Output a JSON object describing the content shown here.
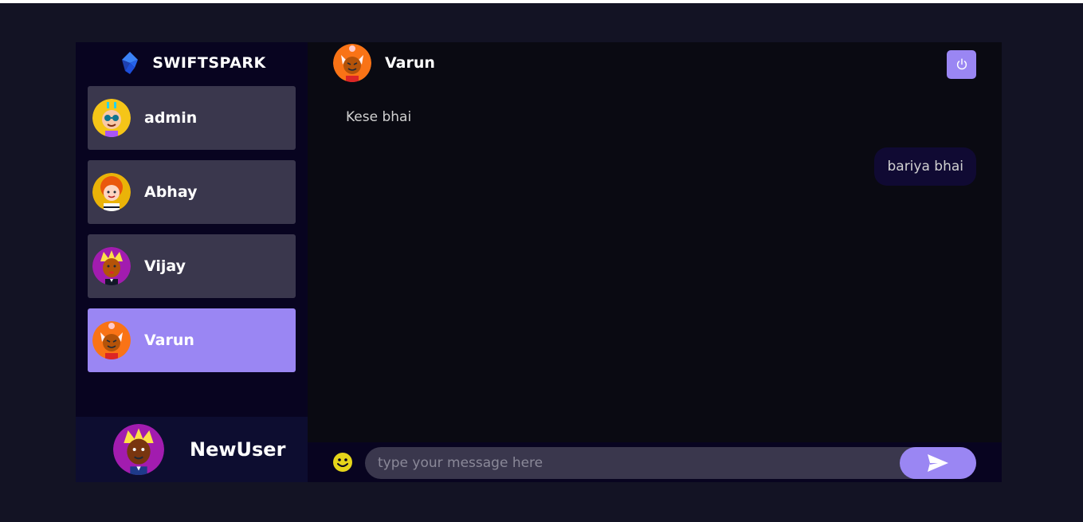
{
  "brand": {
    "name": "SWIFTSPARK",
    "logo_icon": "swiftspark-logo-icon"
  },
  "contacts": [
    {
      "name": "admin",
      "avatar": "avatar-glasses-icon",
      "selected": false
    },
    {
      "name": "Abhay",
      "avatar": "avatar-redhair-icon",
      "selected": false
    },
    {
      "name": "Vijay",
      "avatar": "avatar-blonde-icon",
      "selected": false
    },
    {
      "name": "Varun",
      "avatar": "avatar-orange-icon",
      "selected": true
    }
  ],
  "current_user": {
    "name": "NewUser",
    "avatar": "avatar-blonde-icon"
  },
  "chat": {
    "contact_name": "Varun",
    "logout_icon": "power-icon",
    "messages": [
      {
        "direction": "received",
        "text": "Kese bhai"
      },
      {
        "direction": "sent",
        "text": "bariya bhai"
      }
    ]
  },
  "composer": {
    "placeholder": "type your message here",
    "value": "",
    "emoji_icon": "smiley-icon",
    "send_icon": "send-icon"
  },
  "colors": {
    "accent": "#9a86f3",
    "sidebar_bg": "#080420",
    "chat_bg": "#0a0a12",
    "page_bg": "#131324"
  }
}
